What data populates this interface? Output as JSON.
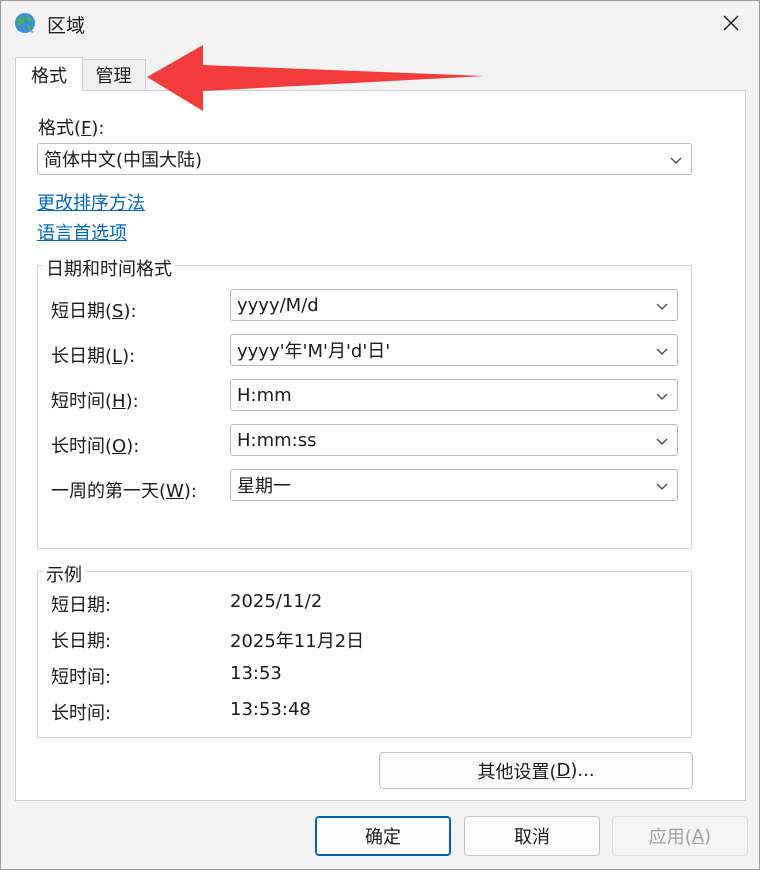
{
  "window": {
    "title": "区域",
    "icon": "globe-icon"
  },
  "tabs": [
    {
      "label": "格式",
      "active": true
    },
    {
      "label": "管理",
      "active": false
    }
  ],
  "format": {
    "label": "格式(",
    "label_key": "F",
    "label_end": "):",
    "value": "简体中文(中国大陆)"
  },
  "links": {
    "sort": "更改排序方法",
    "language": "语言首选项"
  },
  "datetime_group": {
    "title": "日期和时间格式",
    "rows": [
      {
        "label": "短日期(",
        "key": "S",
        "end": "):",
        "value": "yyyy/M/d"
      },
      {
        "label": "长日期(",
        "key": "L",
        "end": "):",
        "value": "yyyy'年'M'月'd'日'"
      },
      {
        "label": "短时间(",
        "key": "H",
        "end": "):",
        "value": "H:mm"
      },
      {
        "label": "长时间(",
        "key": "O",
        "end": "):",
        "value": "H:mm:ss"
      },
      {
        "label": "一周的第一天(",
        "key": "W",
        "end": "):",
        "value": "星期一"
      }
    ]
  },
  "example_group": {
    "title": "示例",
    "rows": [
      {
        "label": "短日期:",
        "value": "2025/11/2"
      },
      {
        "label": "长日期:",
        "value": "2025年11月2日"
      },
      {
        "label": "短时间:",
        "value": "13:53"
      },
      {
        "label": "长时间:",
        "value": "13:53:48"
      }
    ]
  },
  "buttons": {
    "other": {
      "label": "其他设置(",
      "key": "D",
      "end": ")..."
    },
    "ok": "确定",
    "cancel": "取消",
    "apply": {
      "label": "应用(",
      "key": "A",
      "end": ")",
      "disabled": true
    }
  },
  "colors": {
    "link": "#0067c0",
    "arrow": "#f23b3b",
    "primary_border": "#005fb8"
  }
}
